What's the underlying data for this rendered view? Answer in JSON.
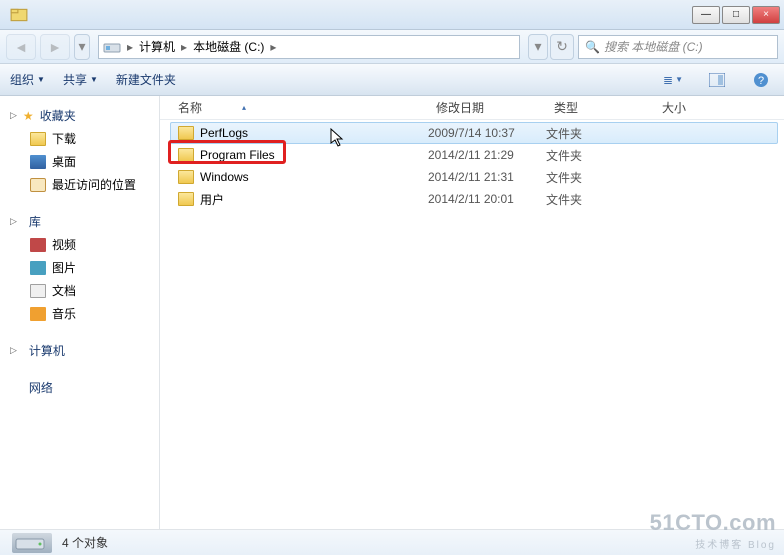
{
  "titlebar": {
    "min": "—",
    "max": "□",
    "close": "×"
  },
  "nav": {
    "back": "◄",
    "fwd": "►",
    "dd": "▾",
    "crumb1": "计算机",
    "crumb2": "本地磁盘 (C:)",
    "sep": "▸",
    "refresh": "▾",
    "reload": "↻",
    "search_placeholder": "搜索 本地磁盘 (C:)",
    "search_icon": "🔍"
  },
  "toolbar": {
    "organize": "组织",
    "share": "共享",
    "newfolder": "新建文件夹",
    "dd": "▼",
    "view_icon": "≣",
    "help_icon": "?"
  },
  "sidebar": {
    "favorites": {
      "label": "收藏夹",
      "arrow": "▷"
    },
    "downloads": "下载",
    "desktop": "桌面",
    "recent": "最近访问的位置",
    "library": {
      "label": "库",
      "arrow": "▷"
    },
    "video": "视频",
    "pictures": "图片",
    "documents": "文档",
    "music": "音乐",
    "computer": {
      "label": "计算机",
      "arrow": "▷"
    },
    "network": {
      "label": "网络"
    }
  },
  "columns": {
    "name": "名称",
    "date": "修改日期",
    "type": "类型",
    "size": "大小",
    "sort": "▴"
  },
  "files": [
    {
      "name": "PerfLogs",
      "date": "2009/7/14 10:37",
      "type": "文件夹"
    },
    {
      "name": "Program Files",
      "date": "2014/2/11 21:29",
      "type": "文件夹"
    },
    {
      "name": "Windows",
      "date": "2014/2/11 21:31",
      "type": "文件夹"
    },
    {
      "name": "用户",
      "date": "2014/2/11 20:01",
      "type": "文件夹"
    }
  ],
  "status": {
    "count": "4 个对象"
  },
  "watermark": {
    "big": "51CTO.com",
    "small": "技术博客    Blog"
  }
}
